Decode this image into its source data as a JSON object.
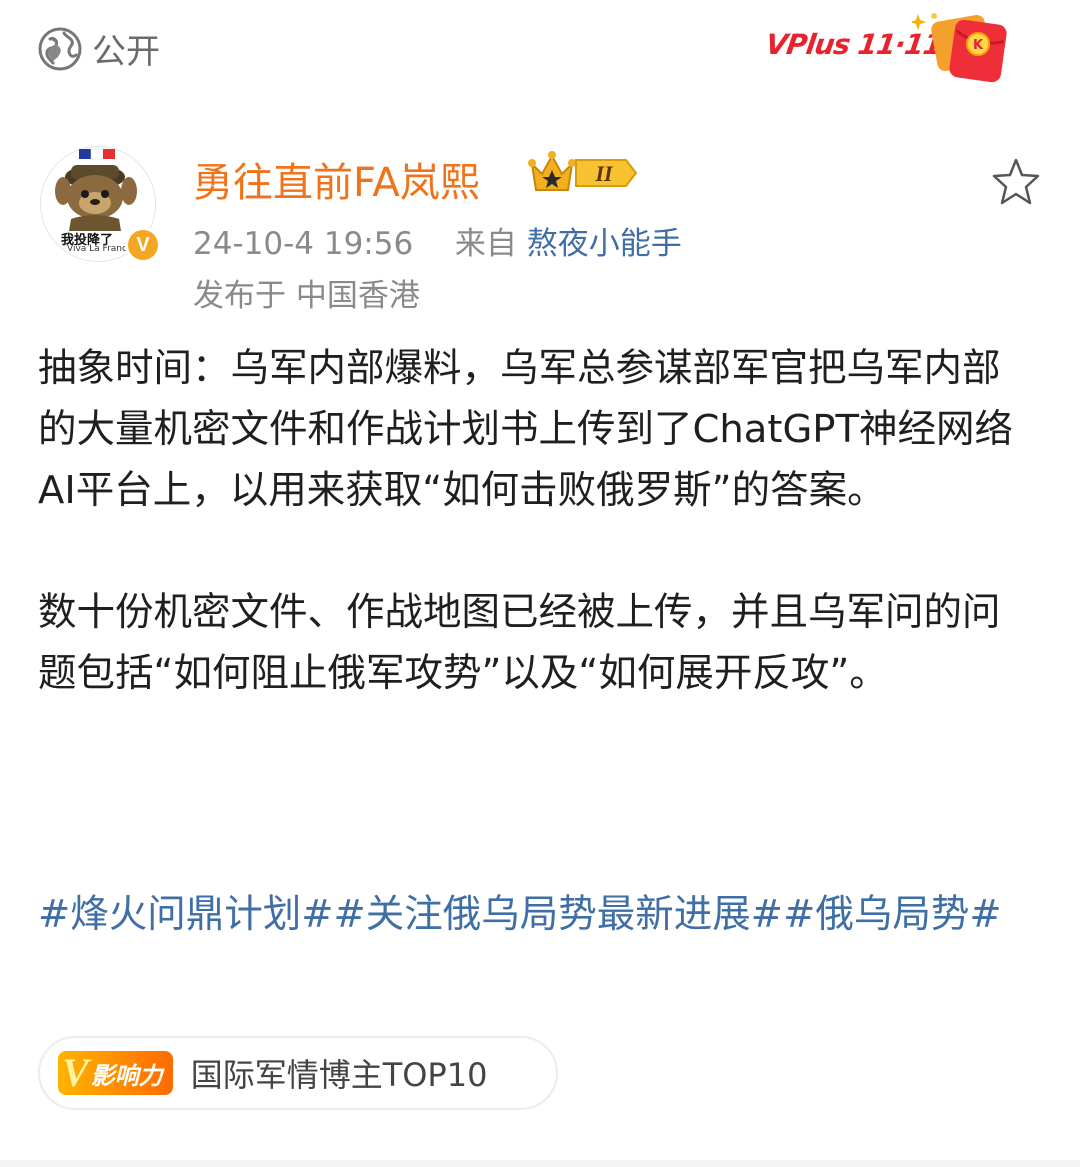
{
  "header": {
    "visibility_label": "公开",
    "campaign_badge": "VPlus 11·11",
    "accent_color": "#e8232e"
  },
  "author": {
    "name": "勇往直前FA岚熙",
    "name_color": "#f0731a",
    "avatar_caption": "我投降了",
    "avatar_subcaption": "Viva La France",
    "verified_mark": "V",
    "crown_level": "II",
    "timestamp": "24-10-4 19:56",
    "source_prefix": "来自",
    "source_app": "熬夜小能手",
    "location": "发布于 中国香港"
  },
  "post": {
    "paragraphs": [
      "抽象时间：乌军内部爆料，乌军总参谋部军官把乌军内部的大量机密文件和作战计划书上传到了ChatGPT神经网络AI平台上，以用来获取“如何击败俄罗斯”的答案。",
      "数十份机密文件、作战地图已经被上传，并且乌军问的问题包括“如何阻止俄军攻势”以及“如何展开反攻”。"
    ],
    "hashtags": [
      "#烽火问鼎计划#",
      "#关注俄乌局势最新进展#",
      "#俄乌局势#"
    ],
    "link_color": "#3f6fa6"
  },
  "influence": {
    "v_mark": "V",
    "tag_label": "影响力",
    "rank_label": "国际军情博主TOP10"
  },
  "icons": {
    "visibility": "globe-icon",
    "favorite": "star-outline-icon",
    "verified": "verified-badge-icon",
    "crown": "crown-icon",
    "campaign": "red-packet-icon"
  }
}
